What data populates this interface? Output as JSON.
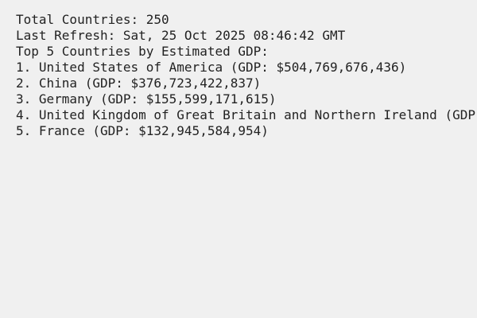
{
  "summary": {
    "total_countries": "Total Countries: 250",
    "last_refresh": "Last Refresh: Sat, 25 Oct 2025 08:46:42 GMT",
    "top_heading": "Top 5 Countries by Estimated GDP:"
  },
  "top_countries": [
    "1. United States of America (GDP: $504,769,676,436)",
    "2. China (GDP: $376,723,422,837)",
    "3. Germany (GDP: $155,599,171,615)",
    "4. United Kingdom of Great Britain and Northern Ireland (GDP",
    "5. France (GDP: $132,945,584,954)"
  ]
}
